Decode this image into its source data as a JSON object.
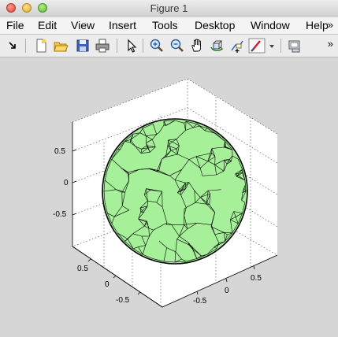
{
  "window": {
    "title": "Figure 1"
  },
  "menubar": {
    "items": [
      "File",
      "Edit",
      "View",
      "Insert",
      "Tools",
      "Desktop",
      "Window",
      "Help"
    ],
    "overflow": "»"
  },
  "toolbar": {
    "buttons": [
      "dock-arrow-icon",
      "new-figure-icon",
      "open-file-icon",
      "save-icon",
      "print-icon",
      "select-pointer-icon",
      "zoom-in-icon",
      "zoom-out-icon",
      "pan-hand-icon",
      "rotate-3d-icon",
      "data-cursor-icon",
      "brush-icon",
      "brush-dropdown-icon",
      "link-plot-icon"
    ],
    "overflow": "»"
  },
  "axes": {
    "z_ticks": [
      "0.5",
      "0",
      "-0.5"
    ],
    "y_ticks": [
      "0.5",
      "0",
      "-0.5"
    ],
    "x_ticks": [
      "-0.5",
      "0",
      "0.5"
    ]
  },
  "colors": {
    "sphere_face": "#a6f09a",
    "edges": "#000000",
    "background": "#d6d6d6",
    "axes_face": "#ffffff"
  }
}
